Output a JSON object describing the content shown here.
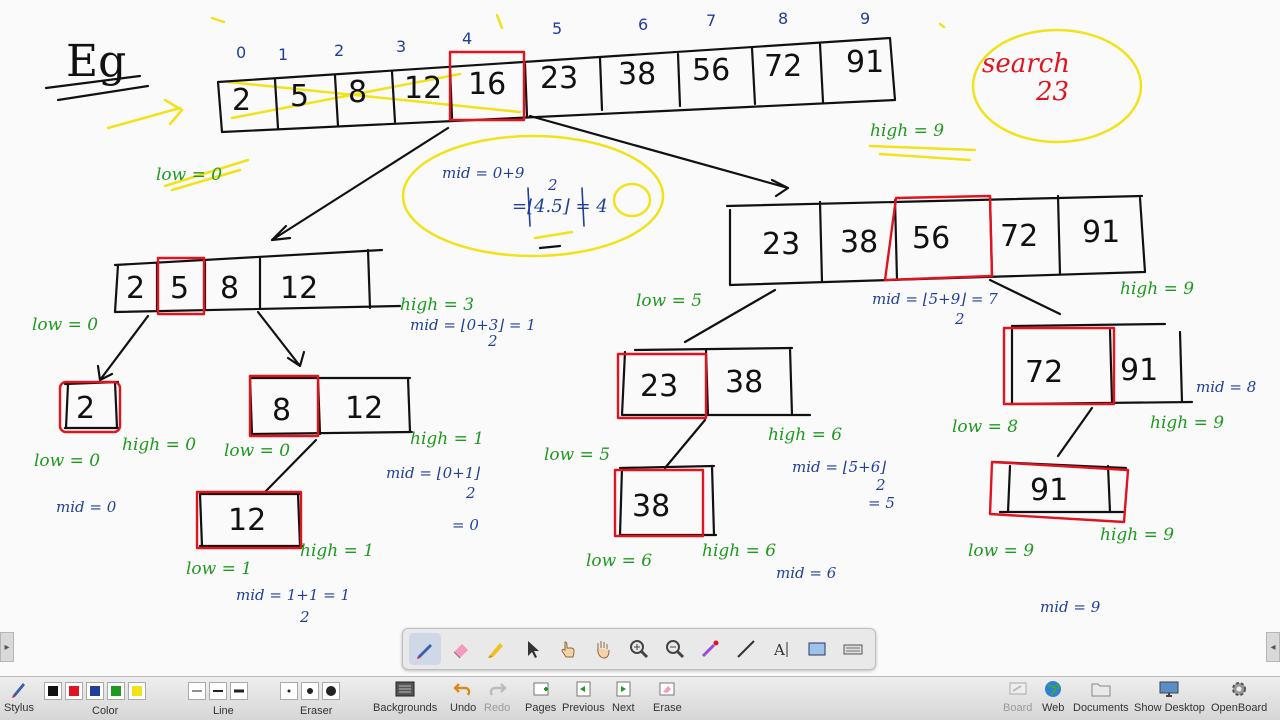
{
  "board": {
    "heading": "Eg",
    "indices": [
      "0",
      "1",
      "2",
      "3",
      "4",
      "5",
      "6",
      "7",
      "8",
      "9"
    ],
    "array": [
      "2",
      "5",
      "8",
      "12",
      "16",
      "23",
      "38",
      "56",
      "72",
      "91"
    ],
    "search_label": "search",
    "search_value": "23",
    "low_top": "low = 0",
    "high_top": "high = 9",
    "mid_calc_1": "mid = 0+9",
    "mid_calc_2": "2",
    "mid_calc_3": "=⌊4.5⌋ = 4",
    "left_array": [
      "2",
      "5",
      "8",
      "12"
    ],
    "left_low": "low = 0",
    "left_high": "high = 3",
    "left_mid_a": "mid = ⌊0+3⌋ = 1",
    "left_mid_b": "2",
    "node_2": "2",
    "node_2_low": "low = 0",
    "node_2_high": "high = 0",
    "node_2_mid": "mid = 0",
    "node_8_12": [
      "8",
      "12"
    ],
    "node_8_low": "low = 0",
    "node_8_high": "high = 1",
    "node_8_mid_a": "mid = ⌊0+1⌋",
    "node_8_mid_b": "2",
    "node_8_mid_c": "= 0",
    "node_12": "12",
    "node_12_low": "low = 1",
    "node_12_high": "high = 1",
    "node_12_mid_a": "mid = 1+1 = 1",
    "node_12_mid_b": "2",
    "right_array": [
      "23",
      "38",
      "56",
      "72",
      "91"
    ],
    "right_mid_a": "mid = ⌊5+9⌋ = 7",
    "right_mid_b": "2",
    "right_low": "low = 5",
    "right_high": "high = 9",
    "node_23_38": [
      "23",
      "38"
    ],
    "node_23_low": "low = 5",
    "node_23_high": "high = 6",
    "node_23_mid_a": "mid = ⌊5+6⌋",
    "node_23_mid_b": "2",
    "node_23_mid_c": "= 5",
    "node_38": "38",
    "node_38_low": "low = 6",
    "node_38_high": "high = 6",
    "node_38_mid": "mid = 6",
    "node_72_91": [
      "72",
      "91"
    ],
    "node_72_low": "low = 8",
    "node_72_high": "high = 9",
    "node_72_mid": "mid = 8",
    "node_91": "91",
    "node_91_low": "low = 9",
    "node_91_high": "high = 9",
    "node_91_mid": "mid = 9",
    "colors": {
      "ink_black": "#111111",
      "ink_red": "#e0141e",
      "ink_blue": "#1f3f9a",
      "ink_green": "#1e9a1e",
      "ink_yellow": "#f2e21a"
    }
  },
  "toolbar": {
    "stylus": "Stylus",
    "color": "Color",
    "line": "Line",
    "eraser": "Eraser",
    "backgrounds": "Backgrounds",
    "undo": "Undo",
    "redo": "Redo",
    "pages": "Pages",
    "previous": "Previous",
    "next": "Next",
    "erase": "Erase",
    "board": "Board",
    "web": "Web",
    "documents": "Documents",
    "show_desktop": "Show Desktop",
    "openboard": "OpenBoard",
    "swatch_colors": [
      "#111111",
      "#e0141e",
      "#1f3f9a",
      "#1e9a1e",
      "#f2e21a"
    ]
  },
  "palette": {
    "tools": [
      "pen-icon",
      "eraser-icon",
      "marker-icon",
      "selector-icon",
      "interactor-icon",
      "hand-icon",
      "zoom-in-icon",
      "zoom-out-icon",
      "laser-pointer-icon",
      "line-icon",
      "text-icon",
      "capture-icon",
      "keyboard-icon"
    ]
  }
}
